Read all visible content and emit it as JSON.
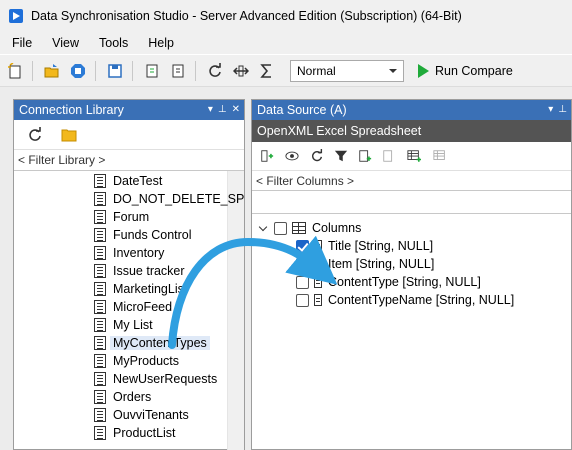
{
  "window": {
    "title": "Data Synchronisation Studio - Server Advanced Edition (Subscription) (64-Bit)"
  },
  "menu": [
    "File",
    "View",
    "Tools",
    "Help"
  ],
  "toolbar": {
    "mode_value": "Normal",
    "run_label": "Run Compare"
  },
  "connection_library": {
    "title": "Connection Library",
    "filter_placeholder": "< Filter Library >",
    "items": [
      {
        "label": "DateTest"
      },
      {
        "label": "DO_NOT_DELETE_SPL"
      },
      {
        "label": "Forum"
      },
      {
        "label": "Funds Control"
      },
      {
        "label": "Inventory"
      },
      {
        "label": "Issue tracker"
      },
      {
        "label": "MarketingList"
      },
      {
        "label": "MicroFeed"
      },
      {
        "label": "My List"
      },
      {
        "label": "MyContentTypes",
        "selected": true
      },
      {
        "label": "MyProducts"
      },
      {
        "label": "NewUserRequests"
      },
      {
        "label": "Orders"
      },
      {
        "label": "OuvviTenants"
      },
      {
        "label": "ProductList"
      }
    ]
  },
  "data_source": {
    "title": "Data Source (A)",
    "subtitle": "OpenXML Excel Spreadsheet",
    "filter_placeholder": "< Filter Columns >",
    "root_label": "Columns",
    "columns": [
      {
        "label": "Title [String, NULL]",
        "checked": true
      },
      {
        "label": "Item [String, NULL]",
        "checked": true
      },
      {
        "label": "ContentType [String, NULL]",
        "checked": false
      },
      {
        "label": "ContentTypeName [String, NULL]",
        "checked": false
      }
    ]
  },
  "colors": {
    "panel_header": "#3a70b6",
    "subheader": "#545454",
    "arrow": "#2f9fe0",
    "checkbox_checked": "#1a64c8"
  }
}
